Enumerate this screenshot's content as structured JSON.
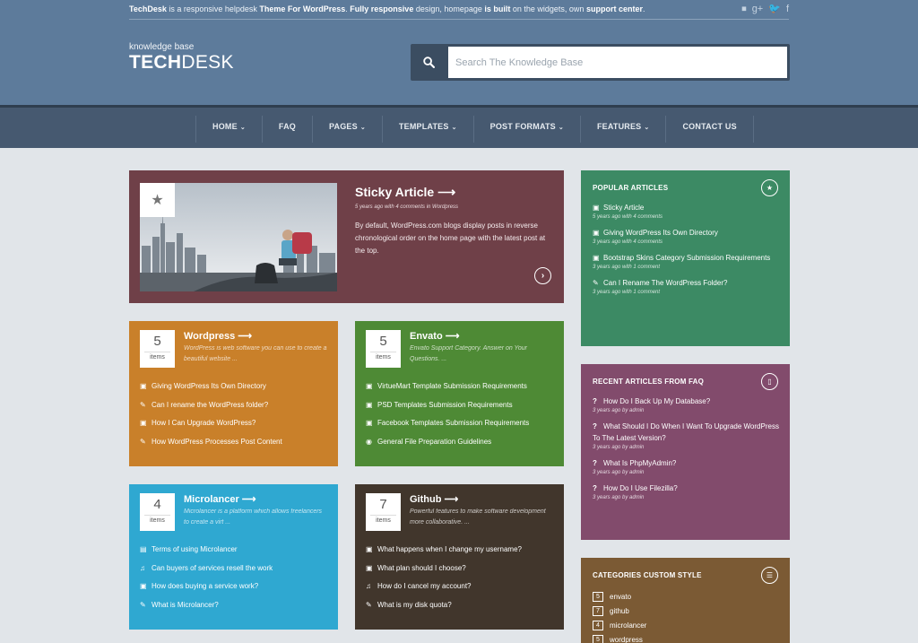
{
  "topbar": {
    "p1": "TechDesk",
    "p2": " is a responsive helpdesk ",
    "p3": "Theme For WordPress",
    "p4": ". ",
    "p5": "Fully responsive",
    "p6": " design, homepage ",
    "p7": "is built",
    "p8": " on the widgets, own ",
    "p9": "support center",
    "p10": "."
  },
  "social": [
    {
      "icon": "apple-icon",
      "glyph": ""
    },
    {
      "icon": "flickr-icon",
      "glyph": "⏹"
    },
    {
      "icon": "google-plus-icon",
      "glyph": "g+"
    },
    {
      "icon": "twitter-icon",
      "glyph": "🐦"
    },
    {
      "icon": "facebook-icon",
      "glyph": "f"
    }
  ],
  "logo": {
    "subtitle": "knowledge base",
    "bold": "TECH",
    "light": "DESK"
  },
  "search": {
    "placeholder": "Search The Knowledge Base"
  },
  "nav": [
    {
      "label": "HOME",
      "dropdown": true
    },
    {
      "label": "FAQ",
      "dropdown": false
    },
    {
      "label": "PAGES",
      "dropdown": true
    },
    {
      "label": "TEMPLATES",
      "dropdown": true
    },
    {
      "label": "POST FORMATS",
      "dropdown": true
    },
    {
      "label": "FEATURES",
      "dropdown": true
    },
    {
      "label": "CONTACT US",
      "dropdown": false
    }
  ],
  "sticky": {
    "title": "Sticky Article ⟶",
    "meta": "5 years ago with 4 comments in Wordpress",
    "text": "By default, WordPress.com blogs display posts in reverse chronological order on the home page with the latest post at the top.",
    "star": "★",
    "more": "›"
  },
  "categories": [
    {
      "count": "5",
      "count_label": "items",
      "title": "Wordpress ⟶",
      "desc": "WordPress is web software you can use to create a beautiful website ...",
      "color": "#c9802a",
      "items": [
        {
          "icon": "image-icon",
          "glyph": "▣",
          "label": "Giving WordPress Its Own Directory"
        },
        {
          "icon": "pencil-icon",
          "glyph": "✎",
          "label": "Can I rename the WordPress folder?"
        },
        {
          "icon": "image-icon",
          "glyph": "▣",
          "label": "How I Can Upgrade WordPress?"
        },
        {
          "icon": "pencil-icon",
          "glyph": "✎",
          "label": "How WordPress Processes Post Content"
        }
      ]
    },
    {
      "count": "5",
      "count_label": "items",
      "title": "Envato ⟶",
      "desc": "Envato Support Category. Answer on Your Questions. ...",
      "color": "#4e8a35",
      "items": [
        {
          "icon": "image-icon",
          "glyph": "▣",
          "label": "VirtueMart Template Submission Requirements"
        },
        {
          "icon": "image-icon",
          "glyph": "▣",
          "label": "PSD Templates Submission Requirements"
        },
        {
          "icon": "image-icon",
          "glyph": "▣",
          "label": "Facebook Templates Submission Requirements"
        },
        {
          "icon": "camera-icon",
          "glyph": "◉",
          "label": "General File Preparation Guidelines"
        }
      ]
    },
    {
      "count": "4",
      "count_label": "items",
      "title": "Microlancer ⟶",
      "desc": "Microlancer is a platform which allows freelancers to create a virt ...",
      "color": "#2fa8d1",
      "items": [
        {
          "icon": "film-icon",
          "glyph": "▤",
          "label": "Terms of using Microlancer"
        },
        {
          "icon": "music-icon",
          "glyph": "♫",
          "label": "Can buyers of services resell the work"
        },
        {
          "icon": "image-icon",
          "glyph": "▣",
          "label": "How does buying a service work?"
        },
        {
          "icon": "pencil-icon",
          "glyph": "✎",
          "label": "What is Microlancer?"
        }
      ]
    },
    {
      "count": "7",
      "count_label": "items",
      "title": "Github ⟶",
      "desc": "Powerful features to make software development more collaborative. ...",
      "color": "#41362c",
      "items": [
        {
          "icon": "image-icon",
          "glyph": "▣",
          "label": "What happens when I change my username?"
        },
        {
          "icon": "image-icon",
          "glyph": "▣",
          "label": "What plan should I choose?"
        },
        {
          "icon": "music-icon",
          "glyph": "♫",
          "label": "How do I cancel my account?"
        },
        {
          "icon": "pencil-icon",
          "glyph": "✎",
          "label": "What is my disk quota?"
        }
      ]
    }
  ],
  "popular": {
    "title": "POPULAR ARTICLES",
    "color": "#3c8a64",
    "icon": "★",
    "items": [
      {
        "icon": "image-icon",
        "glyph": "▣",
        "label": "Sticky Article",
        "meta": "5 years ago with 4 comments"
      },
      {
        "icon": "image-icon",
        "glyph": "▣",
        "label": "Giving WordPress Its Own Directory",
        "meta": "3 years ago with 4 comments"
      },
      {
        "icon": "image-icon",
        "glyph": "▣",
        "label": "Bootstrap Skins Category Submission Requirements",
        "meta": "3 years ago with 1 comment"
      },
      {
        "icon": "pencil-icon",
        "glyph": "✎",
        "label": "Can I Rename The WordPress Folder?",
        "meta": "3 years ago with 1 comment"
      }
    ]
  },
  "faq": {
    "title": "RECENT ARTICLES FROM FAQ",
    "color": "#824b6c",
    "icon": "▯",
    "items": [
      {
        "label": "How Do I Back Up My Database?",
        "meta": "3 years ago by admin"
      },
      {
        "label": "What Should I Do When I Want To Upgrade WordPress To The Latest Version?",
        "meta": "3 years ago by admin"
      },
      {
        "label": "What Is PhpMyAdmin?",
        "meta": "3 years ago by admin"
      },
      {
        "label": "How Do I Use Filezilla?",
        "meta": "3 years ago by admin"
      }
    ]
  },
  "catstyle": {
    "title": "CATEGORIES CUSTOM STYLE",
    "color": "#7b5a34",
    "icon": "☰",
    "items": [
      {
        "count": "5",
        "label": "envato"
      },
      {
        "count": "7",
        "label": "github"
      },
      {
        "count": "4",
        "label": "microlancer"
      },
      {
        "count": "5",
        "label": "wordpress"
      }
    ]
  }
}
